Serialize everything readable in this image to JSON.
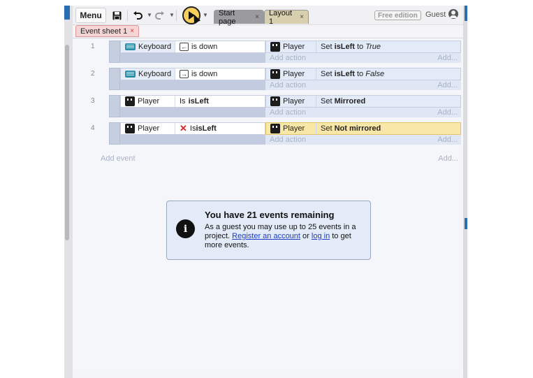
{
  "toolbar": {
    "menu_label": "Menu",
    "tabs": [
      {
        "label": "Start page",
        "close": "×"
      },
      {
        "label": "Layout 1",
        "close": "×"
      }
    ],
    "free_badge": "Free edition",
    "user_label": "Guest"
  },
  "sheet_tab": {
    "label": "Event sheet 1",
    "close": "×"
  },
  "events": [
    {
      "number": "1",
      "condition_object": "Keyboard",
      "condition_key": "←",
      "condition_text": "is down",
      "action_object": "Player",
      "action_prefix": "Set ",
      "action_bold": "isLeft",
      "action_mid": " to ",
      "action_italic": "True",
      "add_action": "Add action",
      "add_more": "Add..."
    },
    {
      "number": "2",
      "condition_object": "Keyboard",
      "condition_key": "→",
      "condition_text": "is down",
      "action_object": "Player",
      "action_prefix": "Set ",
      "action_bold": "isLeft",
      "action_mid": " to ",
      "action_italic": "False",
      "add_action": "Add action",
      "add_more": "Add..."
    },
    {
      "number": "3",
      "condition_object": "Player",
      "condition_prefix": "Is ",
      "condition_bold": "isLeft",
      "action_object": "Player",
      "action_prefix": "Set ",
      "action_bold": "Mirrored",
      "add_action": "Add action",
      "add_more": "Add..."
    },
    {
      "number": "4",
      "condition_object": "Player",
      "condition_inverted": "✕",
      "condition_prefix": "Is ",
      "condition_bold": "isLeft",
      "action_object": "Player",
      "action_prefix": "Set ",
      "action_bold": "Not mirrored",
      "add_action": "Add action",
      "add_more": "Add..."
    }
  ],
  "add_event": {
    "label": "Add event",
    "more": "Add..."
  },
  "notice": {
    "icon": "info-icon",
    "title": "You have 21 events remaining",
    "body_start": "As a guest you may use up to 25 events in a project. ",
    "register_link": "Register an account",
    "body_or": " or ",
    "login_link": "log in",
    "body_end": " to get more events."
  },
  "colors": {
    "play_button": "#f7cf5a",
    "highlight_action": "#f9e7a7",
    "notice_bg": "#e3ebf8",
    "link": "#1a3cc7"
  }
}
